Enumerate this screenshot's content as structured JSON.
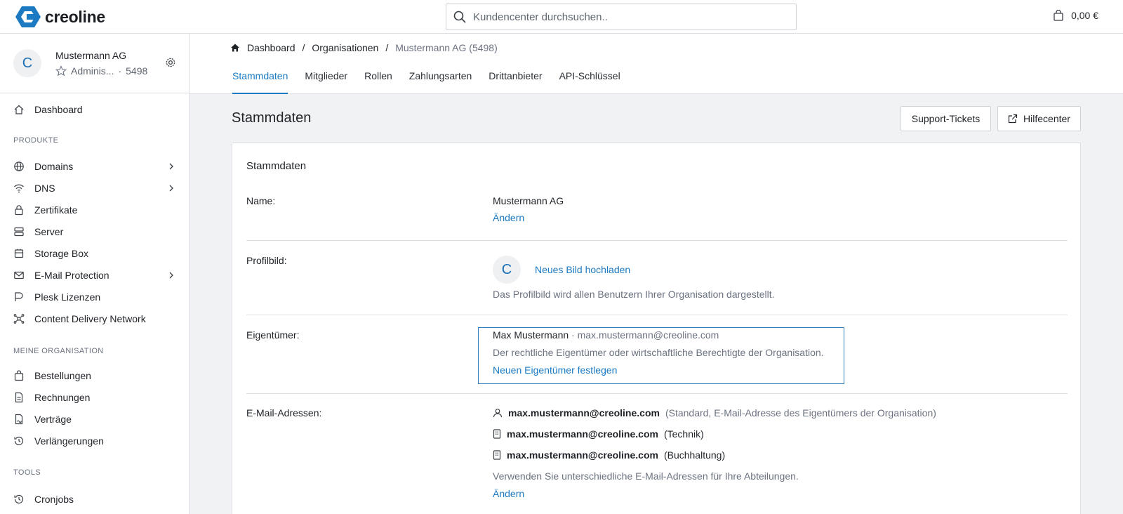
{
  "brand": {
    "name": "creoline",
    "accent": "#1b7ac2"
  },
  "search": {
    "placeholder": "Kundencenter durchsuchen.."
  },
  "cart": {
    "amount": "0,00 €"
  },
  "org": {
    "avatar_letter": "C",
    "name": "Mustermann AG",
    "role": "Adminis...",
    "dot": "·",
    "id": "5498"
  },
  "sidebar": {
    "items": [
      {
        "label": "Dashboard",
        "icon": "home-icon"
      },
      {
        "label": "Domains",
        "icon": "globe-icon"
      },
      {
        "label": "DNS",
        "icon": "wifi-icon"
      },
      {
        "label": "Zertifikate",
        "icon": "lock-icon"
      },
      {
        "label": "Server",
        "icon": "server-icon"
      },
      {
        "label": "Storage Box",
        "icon": "box-icon"
      },
      {
        "label": "E-Mail Protection",
        "icon": "mail-icon"
      },
      {
        "label": "Plesk Lizenzen",
        "icon": "plesk-icon"
      },
      {
        "label": "Content Delivery Network",
        "icon": "network-icon"
      },
      {
        "label": "Bestellungen",
        "icon": "bag-icon"
      },
      {
        "label": "Rechnungen",
        "icon": "invoice-icon"
      },
      {
        "label": "Verträge",
        "icon": "contract-icon"
      },
      {
        "label": "Verlängerungen",
        "icon": "history-icon"
      },
      {
        "label": "Cronjobs",
        "icon": "cron-icon"
      }
    ],
    "sections": {
      "products": "PRODUKTE",
      "organisation": "MEINE ORGANISATION",
      "tools": "TOOLS"
    }
  },
  "breadcrumb": {
    "home": "Dashboard",
    "sep": "/",
    "level1": "Organisationen",
    "current": "Mustermann AG (5498)"
  },
  "tabs": [
    "Stammdaten",
    "Mitglieder",
    "Rollen",
    "Zahlungsarten",
    "Drittanbieter",
    "API-Schlüssel"
  ],
  "page": {
    "title": "Stammdaten",
    "support_label": "Support-Tickets",
    "help_label": "Hilfecenter"
  },
  "card": {
    "title": "Stammdaten",
    "name": {
      "label": "Name:",
      "value": "Mustermann AG",
      "action": "Ändern"
    },
    "profile": {
      "label": "Profilbild:",
      "avatar_letter": "C",
      "action": "Neues Bild hochladen",
      "hint": "Das Profilbild wird allen Benutzern Ihrer Organisation dargestellt."
    },
    "owner": {
      "label": "Eigentümer:",
      "name": "Max Mustermann",
      "dot": "·",
      "email": "max.mustermann@creoline.com",
      "hint": "Der rechtliche Eigentümer oder wirtschaftliche Berechtigte der Organisation.",
      "action": "Neuen Eigentümer festlegen"
    },
    "emails": {
      "label": "E-Mail-Adressen:",
      "list": [
        {
          "address": "max.mustermann@creoline.com",
          "note": "(Standard, E-Mail-Adresse des Eigentümers der Organisation)"
        },
        {
          "address": "max.mustermann@creoline.com",
          "note": "(Technik)"
        },
        {
          "address": "max.mustermann@creoline.com",
          "note": "(Buchhaltung)"
        }
      ],
      "hint": "Verwenden Sie unterschiedliche E-Mail-Adressen für Ihre Abteilungen.",
      "action": "Ändern"
    }
  }
}
